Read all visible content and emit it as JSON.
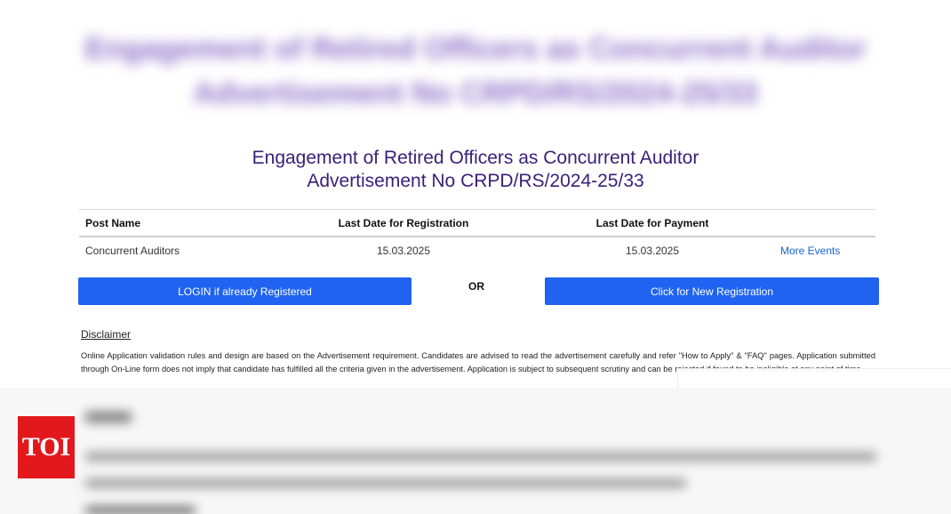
{
  "heading": {
    "line1": "Engagement of Retired Officers as Concurrent Auditor",
    "line2": "Advertisement No CRPD/RS/2024-25/33"
  },
  "table": {
    "headers": [
      "Post Name",
      "Last Date for Registration",
      "Last Date for Payment"
    ],
    "rows": [
      {
        "post": "Concurrent Auditors",
        "reg_date": "15.03.2025",
        "pay_date": "15.03.2025",
        "link": "More Events"
      }
    ]
  },
  "buttons": {
    "login": "LOGIN if already Registered",
    "or": "OR",
    "new_registration": "Click for New Registration"
  },
  "disclaimer": {
    "title": "Disclaimer",
    "text": "Online Application validation rules and design are based on the Advertisement requirement. Candidates are advised to read the advertisement carefully and refer \"How to Apply\" & \"FAQ\" pages. Application submitted through On-Line form does not imply that candidate has fulfilled all the criteria given in the advertisement. Application is subject to subsequent scrutiny and can be rejected if found to be ineligible at any point of time."
  },
  "logo": {
    "text": "TOI"
  },
  "colors": {
    "primary_button": "#1f63f0",
    "heading": "#3a1f78",
    "link": "#1565d8",
    "logo_bg": "#e2181d"
  }
}
